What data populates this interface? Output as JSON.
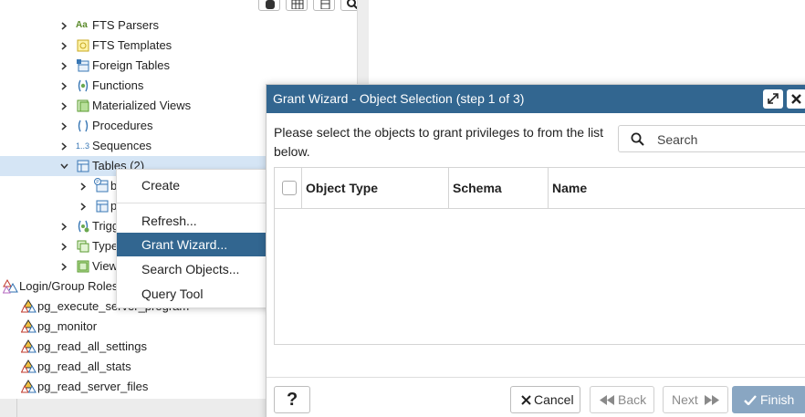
{
  "tree": {
    "items": [
      {
        "label": "FTS Parsers",
        "badge": "Aa"
      },
      {
        "label": "FTS Templates"
      },
      {
        "label": "Foreign Tables"
      },
      {
        "label": "Functions"
      },
      {
        "label": "Materialized Views"
      },
      {
        "label": "Procedures"
      },
      {
        "label": "Sequences",
        "badge": "1..3"
      },
      {
        "label": "Tables (2)"
      },
      {
        "label": "b"
      },
      {
        "label": "p"
      },
      {
        "label": "Trigg"
      },
      {
        "label": "Type"
      },
      {
        "label": "View"
      },
      {
        "label": "Login/Group Roles"
      },
      {
        "label": "pg_execute_server_program"
      },
      {
        "label": "pg_monitor"
      },
      {
        "label": "pg_read_all_settings"
      },
      {
        "label": "pg_read_all_stats"
      },
      {
        "label": "pg_read_server_files"
      }
    ]
  },
  "context_menu": {
    "items": [
      "Create",
      "Refresh...",
      "Grant Wizard...",
      "Search Objects...",
      "Query Tool"
    ],
    "active": "Grant Wizard..."
  },
  "dialog": {
    "title": "Grant Wizard - Object Selection (step 1 of 3)",
    "intro": "Please select the objects to grant privileges to from the list below.",
    "search_placeholder": "Search",
    "columns": [
      "Object Type",
      "Schema",
      "Name"
    ],
    "buttons": {
      "help": "?",
      "cancel": "Cancel",
      "back": "Back",
      "next": "Next",
      "finish": "Finish"
    }
  },
  "colors": {
    "accent": "#326690",
    "selected_row": "#d5e5f5",
    "finish_disabled": "#89a6c2"
  }
}
